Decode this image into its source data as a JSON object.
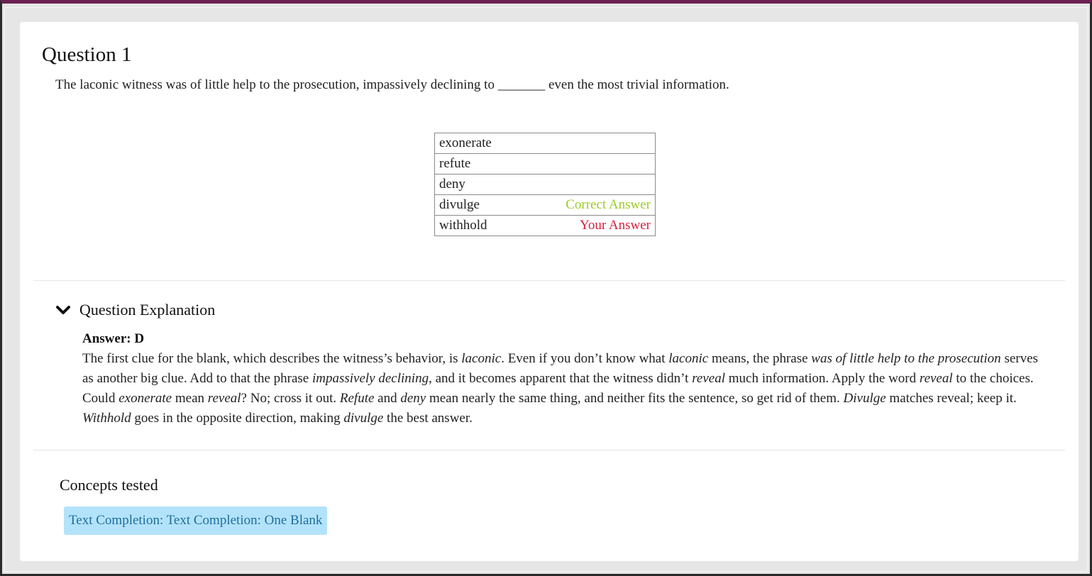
{
  "question": {
    "title": "Question 1",
    "text": "The laconic witness was of little help to the prosecution, impassively declining to _______ even the most trivial information."
  },
  "choices": [
    {
      "label": "exonerate",
      "tag": ""
    },
    {
      "label": "refute",
      "tag": ""
    },
    {
      "label": "deny",
      "tag": ""
    },
    {
      "label": "divulge",
      "tag": "Correct Answer"
    },
    {
      "label": "withhold",
      "tag": "Your Answer"
    }
  ],
  "colors": {
    "correct": "#9ccc23",
    "yours": "#d4213d",
    "concept_bg": "#b3e3fa",
    "concept_text": "#1f6e9c",
    "top_accent": "#6b2150"
  },
  "explanation": {
    "toggle_label": "Question Explanation",
    "toggle_icon": "chevron-down-icon",
    "answer": "Answer: D",
    "s1_a": "The first clue for the blank, which describes the witness’s behavior, is ",
    "s1_b": "laconic",
    "s1_c": ". Even if you don’t know what ",
    "s1_d": "laconic",
    "s1_e": " means, the phrase ",
    "s1_f": "was of little help to the prosecution",
    "s1_g": " serves as another big clue. Add to that the phrase ",
    "s1_h": "impassively declining",
    "s1_i": ", and it becomes apparent that the witness didn’t ",
    "s1_j": "reveal",
    "s1_k": " much information. Apply the word ",
    "s1_l": "reveal",
    "s1_m": " to the choices. Could ",
    "s1_n": "exonerate",
    "s1_o": " mean ",
    "s1_p": "reveal",
    "s1_q": "? No; cross it out. ",
    "s1_r": "Refute",
    "s1_s": " and ",
    "s1_t": "deny",
    "s1_u": " mean nearly the same thing, and neither fits the sentence, so get rid of them. ",
    "s1_v": "Divulge",
    "s1_w": " matches reveal; keep it. ",
    "s1_x": "Withhold",
    "s1_y": " goes in the opposite direction, making ",
    "s1_z": "divulge",
    "s1_end": " the best answer."
  },
  "concepts": {
    "title": "Concepts tested",
    "tags": [
      "Text Completion: Text Completion: One Blank"
    ]
  }
}
